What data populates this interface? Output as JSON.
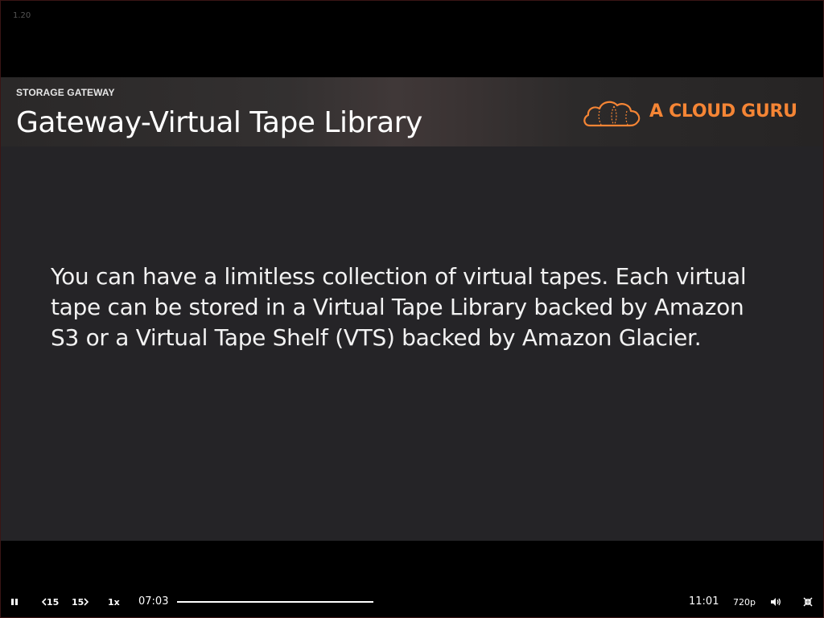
{
  "version": "1.20",
  "slide": {
    "kicker": "STORAGE GATEWAY",
    "title": "Gateway-Virtual Tape Library",
    "body": "You can have a limitless collection of virtual tapes. Each virtual tape can be stored in a Virtual Tape Library backed by Amazon S3 or a Virtual Tape Shelf (VTS) backed by Amazon Glacier."
  },
  "brand": {
    "name": "A CLOUD GURU",
    "color": "#f58535"
  },
  "player": {
    "play_state_icon": "pause-icon",
    "rewind_label": "15",
    "forward_label": "15",
    "speed": "1x",
    "current_time": "07:03",
    "duration": "11:01",
    "quality": "720p",
    "volume_icon": "volume-icon",
    "fullscreen_icon": "exit-fullscreen-icon"
  }
}
